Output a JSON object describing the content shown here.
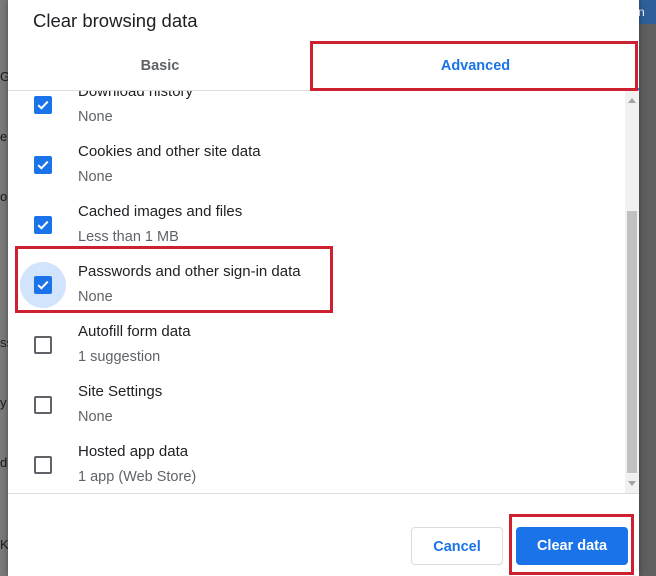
{
  "dialog": {
    "title": "Clear browsing data",
    "tabs": [
      {
        "label": "Basic",
        "selected": false
      },
      {
        "label": "Advanced",
        "selected": true
      }
    ],
    "items": [
      {
        "label": "Download history",
        "sub": "None",
        "checked": true
      },
      {
        "label": "Cookies and other site data",
        "sub": "None",
        "checked": true
      },
      {
        "label": "Cached images and files",
        "sub": "Less than 1 MB",
        "checked": true
      },
      {
        "label": "Passwords and other sign-in data",
        "sub": "None",
        "checked": true
      },
      {
        "label": "Autofill form data",
        "sub": "1 suggestion",
        "checked": false
      },
      {
        "label": "Site Settings",
        "sub": "None",
        "checked": false
      },
      {
        "label": "Hosted app data",
        "sub": "1 app (Web Store)",
        "checked": false
      }
    ],
    "buttons": {
      "cancel": "Cancel",
      "clear": "Clear data"
    }
  },
  "background": {
    "glyphs": [
      "G",
      "e",
      "o",
      "ss",
      "y",
      "d",
      "K"
    ],
    "right_tab": "n"
  },
  "colors": {
    "accent": "#1a73e8",
    "highlight": "#cd2030",
    "checkbox_ripple": "#d2e3fc"
  }
}
